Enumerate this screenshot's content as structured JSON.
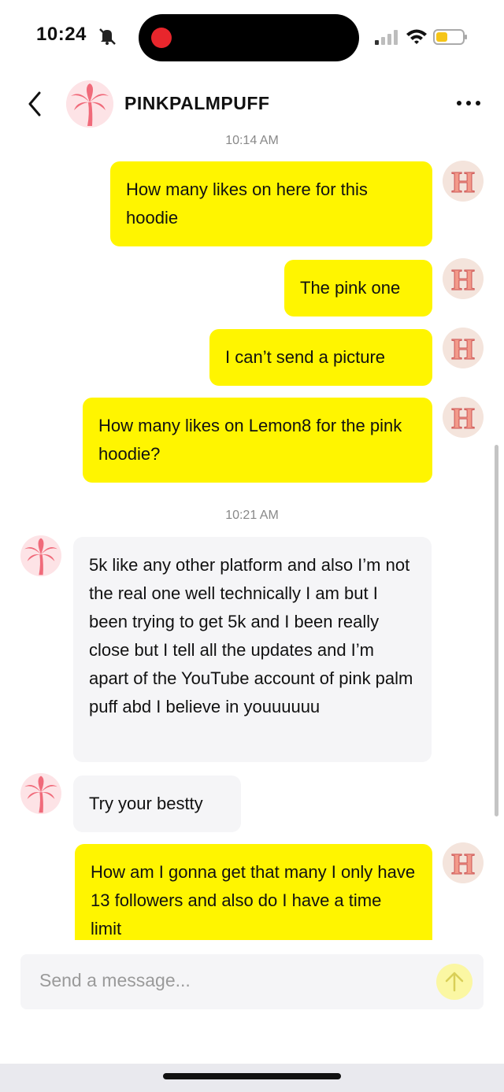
{
  "status_bar": {
    "time": "10:24",
    "icons": [
      "notifications-off-icon",
      "recording-dot-icon",
      "cellular-signal-icon",
      "wifi-icon",
      "battery-icon"
    ]
  },
  "header": {
    "contact_name": "PINKPALMPUFF",
    "icons": [
      "back-chevron-icon",
      "palm-tree-avatar",
      "more-icon"
    ]
  },
  "conversation": {
    "timestamp_1": "10:14 AM",
    "timestamp_2": "10:21 AM",
    "messages": [
      {
        "sender": "me",
        "text": "How many likes on here for this hoodie"
      },
      {
        "sender": "me",
        "text": "The pink one"
      },
      {
        "sender": "me",
        "text": "I can’t send a picture"
      },
      {
        "sender": "me",
        "text": "How many likes on Lemon8 for the pink hoodie?"
      },
      {
        "sender": "them",
        "text": "5k like any other platform and also I’m not the real one well technically I am but I been trying to get 5k and I been really close but I tell all the updates and I’m apart of the YouTube account of pink palm puff abd I believe in youuuuuu"
      },
      {
        "sender": "them",
        "text": "Try your bestty"
      },
      {
        "sender": "me",
        "text": "How am I gonna get that many I only have 13 followers and also do I have a time limit"
      }
    ]
  },
  "composer": {
    "placeholder": "Send a message...",
    "send_icon": "arrow-up-icon"
  },
  "colors": {
    "outgoing_bubble": "#fff500",
    "incoming_bubble": "#f5f5f7",
    "timestamp": "#888888",
    "send_button": "#fbf7a3",
    "record_dot": "#e8262c"
  }
}
